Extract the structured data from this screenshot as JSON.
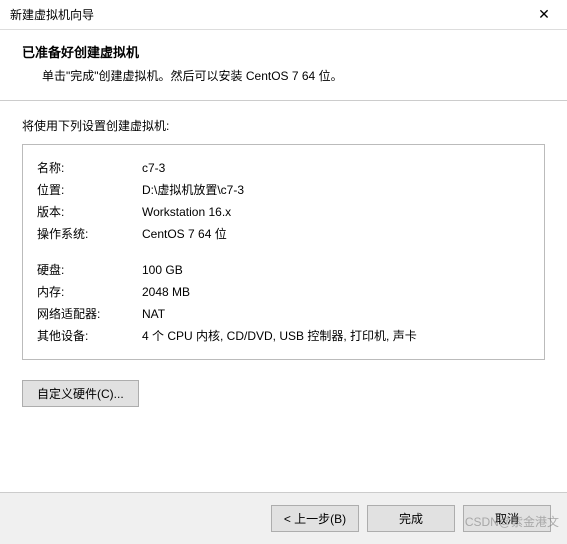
{
  "window": {
    "title": "新建虚拟机向导",
    "close": "✕"
  },
  "header": {
    "heading": "已准备好创建虚拟机",
    "subtitle": "单击\"完成\"创建虚拟机。然后可以安装 CentOS 7 64 位。"
  },
  "lead": "将使用下列设置创建虚拟机:",
  "config": {
    "name_label": "名称:",
    "name_value": "c7-3",
    "location_label": "位置:",
    "location_value": "D:\\虚拟机放置\\c7-3",
    "version_label": "版本:",
    "version_value": "Workstation 16.x",
    "os_label": "操作系统:",
    "os_value": "CentOS 7 64 位",
    "disk_label": "硬盘:",
    "disk_value": "100 GB",
    "memory_label": "内存:",
    "memory_value": "2048 MB",
    "network_label": "网络适配器:",
    "network_value": "NAT",
    "other_label": "其他设备:",
    "other_value": "4 个 CPU 内核, CD/DVD, USB 控制器, 打印机, 声卡"
  },
  "buttons": {
    "customize": "自定义硬件(C)...",
    "back": "< 上一步(B)",
    "finish": "完成",
    "cancel": "取消"
  },
  "watermark": "CSDN@紫金港文"
}
